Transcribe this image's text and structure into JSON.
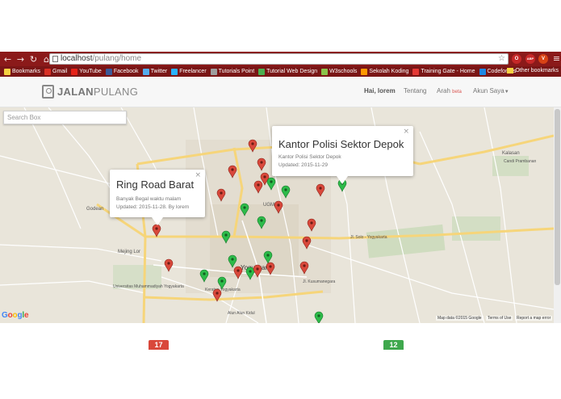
{
  "browser": {
    "url_host": "localhost",
    "url_path": "/pulang/home",
    "nav_icons": [
      "back-icon",
      "forward-icon",
      "reload-icon",
      "home-icon"
    ],
    "extensions": [
      {
        "name": "opera-icon",
        "color": "#c62828",
        "label": "O"
      },
      {
        "name": "adblock-icon",
        "color": "#c62828",
        "label": "ABP"
      },
      {
        "name": "shield-icon",
        "color": "#d84315",
        "label": "V"
      }
    ]
  },
  "bookmarks": {
    "items": [
      {
        "label": "Bookmarks",
        "color": "#f5d142"
      },
      {
        "label": "Gmail",
        "color": "#d93025"
      },
      {
        "label": "YouTube",
        "color": "#e62117"
      },
      {
        "label": "Facebook",
        "color": "#3b5998"
      },
      {
        "label": "Twitter",
        "color": "#55acee"
      },
      {
        "label": "Freelancer",
        "color": "#29b2fe"
      },
      {
        "label": "Tutorials Point",
        "color": "#9e9e9e"
      },
      {
        "label": "Tutorial Web Design",
        "color": "#4caf50"
      },
      {
        "label": "W3schools",
        "color": "#8bc34a"
      },
      {
        "label": "Sekolah Koding",
        "color": "#ff9800"
      },
      {
        "label": "Training Gate - Home",
        "color": "#e53935"
      },
      {
        "label": "Codeforces",
        "color": "#1e88e5"
      }
    ],
    "other": "Other bookmarks"
  },
  "site": {
    "logo_part1": "JALAN",
    "logo_part2": "PULANG",
    "menu": {
      "greeting": "Hai, lorem",
      "about": "Tentang",
      "direction": "Arah",
      "beta": "beta",
      "account": "Akun Saya"
    }
  },
  "map": {
    "search_placeholder": "Search Box",
    "info_windows": [
      {
        "title": "Ring Road Barat",
        "desc1": "Banyak Begal waktu malam",
        "desc2": "Updated: 2015-11-28. By lorem"
      },
      {
        "title": "Kantor Polisi Sektor Depok",
        "desc1": "Kantor Polisi Sektor Depok",
        "desc2": "Updated: 2015-11-29"
      }
    ],
    "google": "Google",
    "map_data": "Map data ©2015 Google",
    "terms": "Terms of Use",
    "report": "Report a map error",
    "labels": {
      "godean": "Godean",
      "mejing_lor": "Mejing Lor",
      "yogyakarta": "Yogyakarta",
      "ugm": "UGM",
      "kalasan": "Kalasan",
      "candi": "Candi Prambanan",
      "solo": "Jl. Solo - Yogyakarta",
      "umy": "Universitas Muhammadiyah Yogyakarta",
      "alun": "Alun Alun Kidul",
      "kusumanegara": "Jl. Kusumanegara",
      "keraton": "Keraton Yogyakarta"
    },
    "pin_colors": {
      "danger": "#d9483b",
      "safe": "#2dbb4a"
    }
  },
  "counters": {
    "danger": "17",
    "danger_color": "#d9483b",
    "safe": "12",
    "safe_color": "#3fa84d"
  }
}
